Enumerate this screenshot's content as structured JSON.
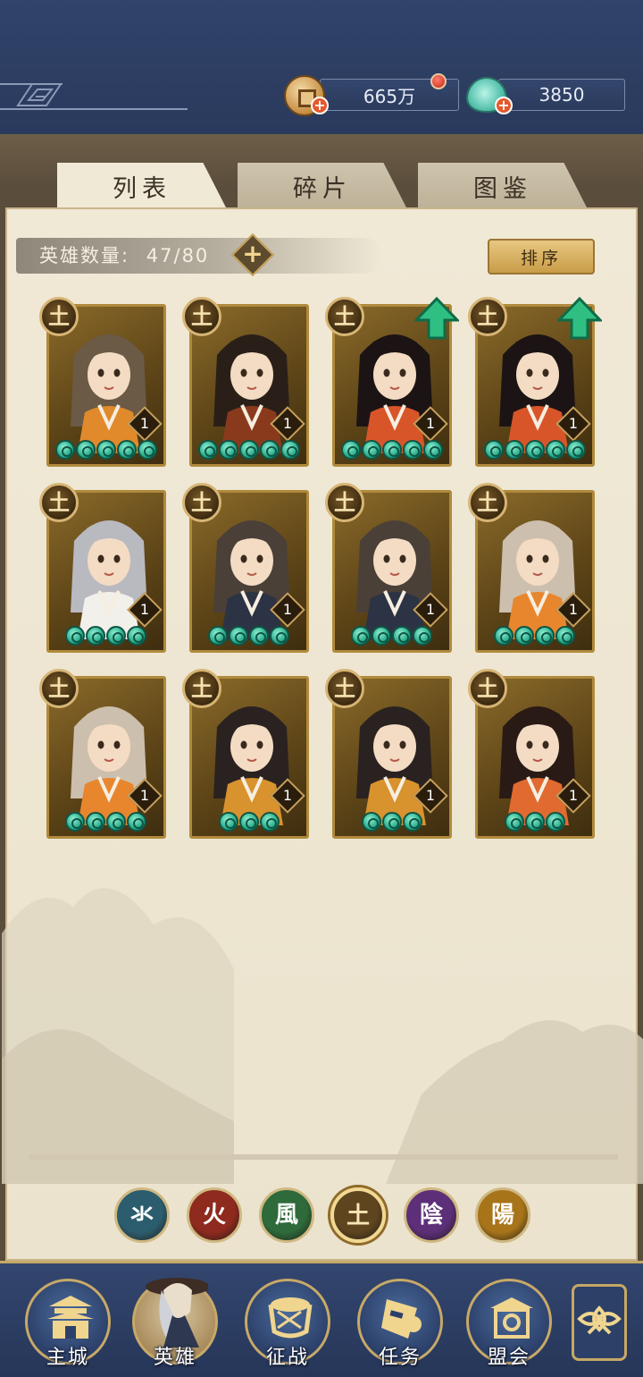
{
  "currency": {
    "coins_value": "665万",
    "gems_value": "3850"
  },
  "tabs": [
    {
      "label": "列表",
      "active": true
    },
    {
      "label": "碎片",
      "active": false
    },
    {
      "label": "图鉴",
      "active": false
    }
  ],
  "hero_count": {
    "label": "英雄数量:",
    "value": "47/80"
  },
  "sort_button": "排序",
  "heroes": [
    {
      "element": "土",
      "level": "1",
      "stars": 5,
      "upgrade": false,
      "hair": "#6b5a45",
      "outfit": "#e08a2c"
    },
    {
      "element": "土",
      "level": "1",
      "stars": 5,
      "upgrade": false,
      "hair": "#2a1f18",
      "outfit": "#8a3a1c"
    },
    {
      "element": "土",
      "level": "1",
      "stars": 5,
      "upgrade": true,
      "hair": "#1c1414",
      "outfit": "#d8552a"
    },
    {
      "element": "土",
      "level": "1",
      "stars": 5,
      "upgrade": true,
      "hair": "#1c1414",
      "outfit": "#d8552a"
    },
    {
      "element": "土",
      "level": "1",
      "stars": 4,
      "upgrade": false,
      "hair": "#b9b9c0",
      "outfit": "#f2f0ea"
    },
    {
      "element": "土",
      "level": "1",
      "stars": 4,
      "upgrade": false,
      "hair": "#4a4038",
      "outfit": "#2c3344"
    },
    {
      "element": "土",
      "level": "1",
      "stars": 4,
      "upgrade": false,
      "hair": "#4a4038",
      "outfit": "#2c3344"
    },
    {
      "element": "土",
      "level": "1",
      "stars": 4,
      "upgrade": false,
      "hair": "#cdbfae",
      "outfit": "#e8862e"
    },
    {
      "element": "土",
      "level": "1",
      "stars": 4,
      "upgrade": false,
      "hair": "#cdbfae",
      "outfit": "#e8862e"
    },
    {
      "element": "土",
      "level": "1",
      "stars": 3,
      "upgrade": false,
      "hair": "#2a2220",
      "outfit": "#d8922e"
    },
    {
      "element": "土",
      "level": "1",
      "stars": 3,
      "upgrade": false,
      "hair": "#2a2220",
      "outfit": "#d8922e"
    },
    {
      "element": "土",
      "level": "1",
      "stars": 3,
      "upgrade": false,
      "hair": "#2a1a16",
      "outfit": "#e06a30"
    }
  ],
  "element_filters": [
    {
      "glyph": "氺",
      "name": "water",
      "color": "#2c5d6e",
      "selected": false
    },
    {
      "glyph": "火",
      "name": "fire",
      "color": "#8e2a1e",
      "selected": false
    },
    {
      "glyph": "風",
      "name": "wind",
      "color": "#2e6a3a",
      "selected": false
    },
    {
      "glyph": "土",
      "name": "earth",
      "color": "#5e4520",
      "selected": true
    },
    {
      "glyph": "陰",
      "name": "yin",
      "color": "#5c2f78",
      "selected": false
    },
    {
      "glyph": "陽",
      "name": "yang",
      "color": "#a8741a",
      "selected": false
    }
  ],
  "nav": [
    {
      "label": "主城",
      "active": false
    },
    {
      "label": "英雄",
      "active": true
    },
    {
      "label": "征战",
      "active": false
    },
    {
      "label": "任务",
      "active": false
    },
    {
      "label": "盟会",
      "active": false
    }
  ]
}
